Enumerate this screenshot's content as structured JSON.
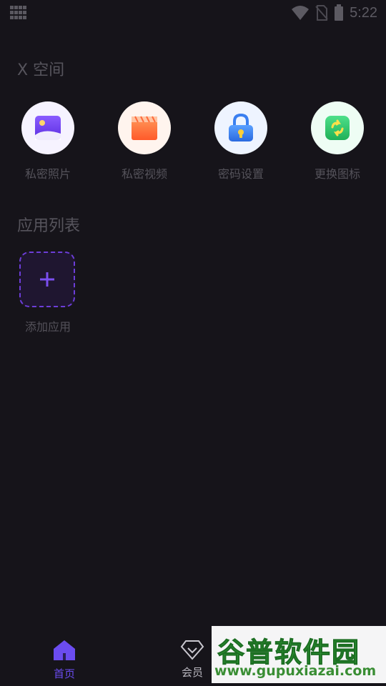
{
  "status_bar": {
    "time": "5:22",
    "icons": [
      "app-grid-icon",
      "wifi-icon",
      "no-sim-icon",
      "battery-icon"
    ]
  },
  "space_section": {
    "title": "X 空间",
    "items": [
      {
        "label": "私密照片",
        "icon": "photo-icon",
        "accent": "#6a3df0"
      },
      {
        "label": "私密视频",
        "icon": "video-icon",
        "accent": "#ff6a3a"
      },
      {
        "label": "密码设置",
        "icon": "lock-icon",
        "accent": "#2f7cf0"
      },
      {
        "label": "更换图标",
        "icon": "swap-icon",
        "accent": "#2ec46a"
      }
    ]
  },
  "apps_section": {
    "title": "应用列表",
    "add_label": "添加应用"
  },
  "bottom_nav": {
    "items": [
      {
        "label": "首页",
        "icon": "home-icon",
        "active": true
      },
      {
        "label": "会员",
        "icon": "diamond-icon",
        "active": false
      }
    ],
    "active_color": "#6b4cf0"
  },
  "watermark": {
    "title": "谷普软件园",
    "url": "www.gupuxiazai.com"
  },
  "colors": {
    "background": "#16141a",
    "accent": "#6c3dd8"
  }
}
